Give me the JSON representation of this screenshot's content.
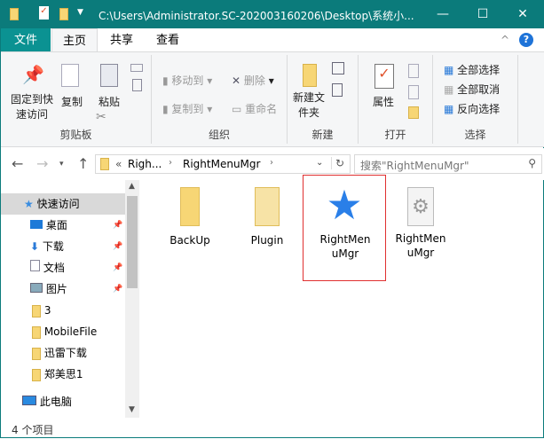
{
  "window": {
    "title": "C:\\Users\\Administrator.SC-202003160206\\Desktop\\系统小...",
    "minimize": "—",
    "maximize": "☐",
    "close": "✕"
  },
  "tabs": {
    "file": "文件",
    "home": "主页",
    "share": "共享",
    "view": "查看"
  },
  "ribbon": {
    "clipboard": {
      "label": "剪贴板",
      "pin": "固定到快速访问",
      "copy": "复制",
      "paste": "粘贴"
    },
    "organize": {
      "label": "组织",
      "move_to": "移动到",
      "copy_to": "复制到",
      "delete": "删除",
      "rename": "重命名"
    },
    "new": {
      "label": "新建",
      "new_folder": "新建文件夹"
    },
    "open": {
      "label": "打开",
      "properties": "属性"
    },
    "select": {
      "label": "选择",
      "select_all": "全部选择",
      "select_none": "全部取消",
      "invert": "反向选择"
    }
  },
  "address": {
    "overflow": "«",
    "crumb1": "Righ...",
    "crumb2": "RightMenuMgr",
    "search_placeholder": "搜索\"RightMenuMgr\""
  },
  "nav": {
    "quick_access": "快速访问",
    "items": [
      "桌面",
      "下载",
      "文档",
      "图片",
      "3",
      "MobileFile",
      "迅雷下载",
      "郑美思1"
    ],
    "this_pc": "此电脑"
  },
  "files": [
    {
      "name": "BackUp"
    },
    {
      "name": "Plugin"
    },
    {
      "name": "RightMenuMgr"
    },
    {
      "name": "RightMenuMgr"
    }
  ],
  "status": {
    "count": "4 个项目"
  },
  "colors": {
    "titlebar": "#0b7b7b",
    "selection_border": "#e03030"
  }
}
